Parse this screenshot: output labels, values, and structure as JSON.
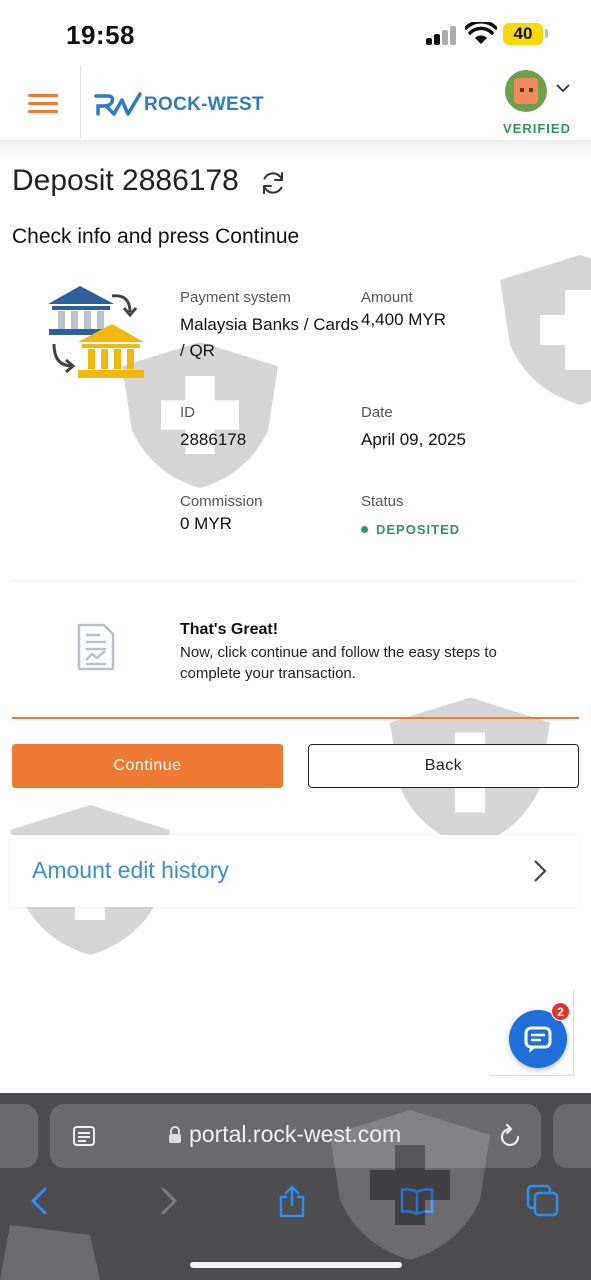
{
  "status_bar": {
    "time": "19:58",
    "battery": "40"
  },
  "header": {
    "brand": "ROCK-WEST",
    "verification": "VERIFIED",
    "colors": {
      "accent": "#ef7a33",
      "brand_blue": "#2f7ac9",
      "success": "#2e9a55"
    }
  },
  "page": {
    "title": "Deposit 2886178",
    "subtitle": "Check info and press Continue"
  },
  "details": {
    "payment_system": {
      "label": "Payment system",
      "value": "Malaysia Banks / Cards / QR"
    },
    "amount": {
      "label": "Amount",
      "value": "4,400 MYR"
    },
    "id": {
      "label": "ID",
      "value": "2886178"
    },
    "date": {
      "label": "Date",
      "value": "April 09, 2025"
    },
    "commission": {
      "label": "Commission",
      "value": "0 MYR"
    },
    "status": {
      "label": "Status",
      "value": "DEPOSITED"
    }
  },
  "note": {
    "title": "That's Great!",
    "body": "Now, click continue and follow the easy steps to complete your transaction."
  },
  "actions": {
    "continue": "Continue",
    "back": "Back"
  },
  "history": {
    "label": "Amount edit history"
  },
  "chat": {
    "badge": "2"
  },
  "browser": {
    "url": "portal.rock-west.com"
  },
  "icons": [
    "hamburger-menu-icon",
    "refresh-icon",
    "bank-transfer-icon",
    "document-icon",
    "chevron-right-icon",
    "chat-icon",
    "lock-icon",
    "reader-icon",
    "reload-icon",
    "back-icon",
    "forward-icon",
    "share-icon",
    "bookmarks-icon",
    "tabs-icon"
  ]
}
